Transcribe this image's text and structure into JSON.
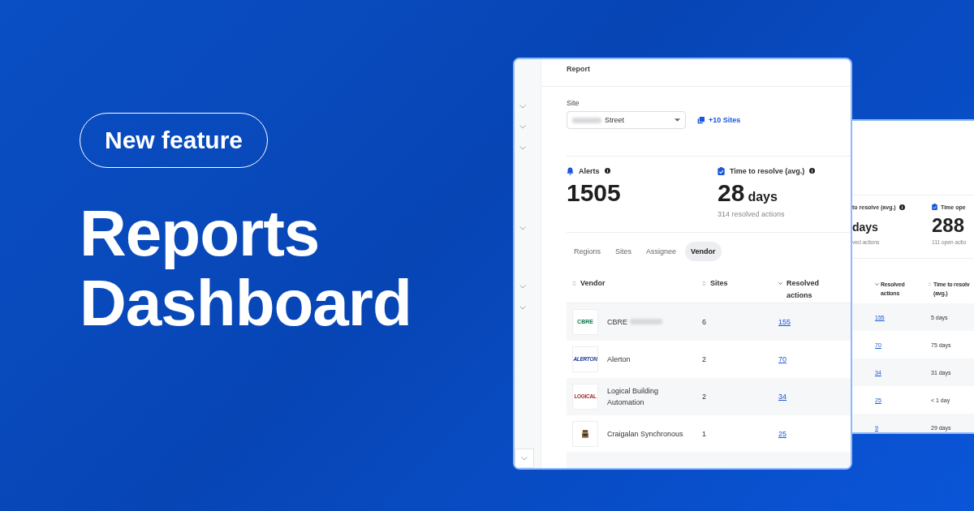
{
  "banner": {
    "badge": "New feature",
    "title_lines": [
      "Reports",
      "Dashboard"
    ]
  },
  "report": {
    "title": "Report",
    "site": {
      "label": "Site",
      "value": "Street",
      "extra": "+10 Sites"
    },
    "stats": [
      {
        "kind": "alerts",
        "label": "Alerts",
        "value": "1505"
      },
      {
        "kind": "time",
        "label": "Time to resolve (avg.)",
        "value": "28",
        "unit": "days",
        "note": "314 resolved actions"
      }
    ],
    "tabs": [
      {
        "label": "Regions",
        "selected": false
      },
      {
        "label": "Sites",
        "selected": false
      },
      {
        "label": "Assignee",
        "selected": false
      },
      {
        "label": "Vendor",
        "selected": true
      }
    ],
    "table": {
      "columns": [
        {
          "label": "Vendor",
          "kind": "sortable"
        },
        {
          "label": "Sites",
          "kind": "sortable"
        },
        {
          "label": "Resolved actions",
          "kind": "sorted"
        }
      ],
      "rows": [
        {
          "logo": {
            "kind": "cbre",
            "text": "CBRE"
          },
          "vendor": "CBRE",
          "redacted": true,
          "sites": "6",
          "resolved": "155"
        },
        {
          "logo": {
            "kind": "alerton",
            "text": "ALERTON"
          },
          "vendor": "Alerton",
          "redacted": false,
          "sites": "2",
          "resolved": "70"
        },
        {
          "logo": {
            "kind": "logical",
            "text": "LOGICAL"
          },
          "vendor": "Logical Building Automation",
          "redacted": false,
          "sites": "2",
          "resolved": "34"
        },
        {
          "logo": {
            "kind": "crate"
          },
          "vendor": "Craigalan Synchronous",
          "redacted": false,
          "sites": "1",
          "resolved": "25"
        }
      ]
    }
  },
  "back_report": {
    "stats": [
      {
        "kind": "info",
        "label": "to resolve (avg.)",
        "value": "days",
        "note": "ved actions"
      },
      {
        "kind": "time",
        "label": "Time ope",
        "value": "288",
        "note": "111 open actio"
      }
    ],
    "columns": [
      "Resolved actions",
      "Time to resolv (avg.)"
    ],
    "rows": [
      [
        "155",
        "5 days"
      ],
      [
        "70",
        "75 days"
      ],
      [
        "34",
        "31 days"
      ],
      [
        "25",
        "< 1 day"
      ],
      [
        "9",
        "29 days"
      ]
    ]
  }
}
